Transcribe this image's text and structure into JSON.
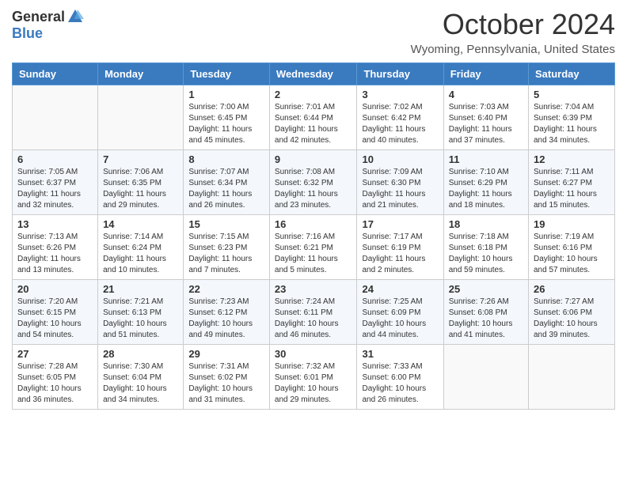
{
  "header": {
    "logo_general": "General",
    "logo_blue": "Blue",
    "month_title": "October 2024",
    "location": "Wyoming, Pennsylvania, United States"
  },
  "days_of_week": [
    "Sunday",
    "Monday",
    "Tuesday",
    "Wednesday",
    "Thursday",
    "Friday",
    "Saturday"
  ],
  "weeks": [
    [
      {
        "day": "",
        "info": ""
      },
      {
        "day": "",
        "info": ""
      },
      {
        "day": "1",
        "info": "Sunrise: 7:00 AM\nSunset: 6:45 PM\nDaylight: 11 hours and 45 minutes."
      },
      {
        "day": "2",
        "info": "Sunrise: 7:01 AM\nSunset: 6:44 PM\nDaylight: 11 hours and 42 minutes."
      },
      {
        "day": "3",
        "info": "Sunrise: 7:02 AM\nSunset: 6:42 PM\nDaylight: 11 hours and 40 minutes."
      },
      {
        "day": "4",
        "info": "Sunrise: 7:03 AM\nSunset: 6:40 PM\nDaylight: 11 hours and 37 minutes."
      },
      {
        "day": "5",
        "info": "Sunrise: 7:04 AM\nSunset: 6:39 PM\nDaylight: 11 hours and 34 minutes."
      }
    ],
    [
      {
        "day": "6",
        "info": "Sunrise: 7:05 AM\nSunset: 6:37 PM\nDaylight: 11 hours and 32 minutes."
      },
      {
        "day": "7",
        "info": "Sunrise: 7:06 AM\nSunset: 6:35 PM\nDaylight: 11 hours and 29 minutes."
      },
      {
        "day": "8",
        "info": "Sunrise: 7:07 AM\nSunset: 6:34 PM\nDaylight: 11 hours and 26 minutes."
      },
      {
        "day": "9",
        "info": "Sunrise: 7:08 AM\nSunset: 6:32 PM\nDaylight: 11 hours and 23 minutes."
      },
      {
        "day": "10",
        "info": "Sunrise: 7:09 AM\nSunset: 6:30 PM\nDaylight: 11 hours and 21 minutes."
      },
      {
        "day": "11",
        "info": "Sunrise: 7:10 AM\nSunset: 6:29 PM\nDaylight: 11 hours and 18 minutes."
      },
      {
        "day": "12",
        "info": "Sunrise: 7:11 AM\nSunset: 6:27 PM\nDaylight: 11 hours and 15 minutes."
      }
    ],
    [
      {
        "day": "13",
        "info": "Sunrise: 7:13 AM\nSunset: 6:26 PM\nDaylight: 11 hours and 13 minutes."
      },
      {
        "day": "14",
        "info": "Sunrise: 7:14 AM\nSunset: 6:24 PM\nDaylight: 11 hours and 10 minutes."
      },
      {
        "day": "15",
        "info": "Sunrise: 7:15 AM\nSunset: 6:23 PM\nDaylight: 11 hours and 7 minutes."
      },
      {
        "day": "16",
        "info": "Sunrise: 7:16 AM\nSunset: 6:21 PM\nDaylight: 11 hours and 5 minutes."
      },
      {
        "day": "17",
        "info": "Sunrise: 7:17 AM\nSunset: 6:19 PM\nDaylight: 11 hours and 2 minutes."
      },
      {
        "day": "18",
        "info": "Sunrise: 7:18 AM\nSunset: 6:18 PM\nDaylight: 10 hours and 59 minutes."
      },
      {
        "day": "19",
        "info": "Sunrise: 7:19 AM\nSunset: 6:16 PM\nDaylight: 10 hours and 57 minutes."
      }
    ],
    [
      {
        "day": "20",
        "info": "Sunrise: 7:20 AM\nSunset: 6:15 PM\nDaylight: 10 hours and 54 minutes."
      },
      {
        "day": "21",
        "info": "Sunrise: 7:21 AM\nSunset: 6:13 PM\nDaylight: 10 hours and 51 minutes."
      },
      {
        "day": "22",
        "info": "Sunrise: 7:23 AM\nSunset: 6:12 PM\nDaylight: 10 hours and 49 minutes."
      },
      {
        "day": "23",
        "info": "Sunrise: 7:24 AM\nSunset: 6:11 PM\nDaylight: 10 hours and 46 minutes."
      },
      {
        "day": "24",
        "info": "Sunrise: 7:25 AM\nSunset: 6:09 PM\nDaylight: 10 hours and 44 minutes."
      },
      {
        "day": "25",
        "info": "Sunrise: 7:26 AM\nSunset: 6:08 PM\nDaylight: 10 hours and 41 minutes."
      },
      {
        "day": "26",
        "info": "Sunrise: 7:27 AM\nSunset: 6:06 PM\nDaylight: 10 hours and 39 minutes."
      }
    ],
    [
      {
        "day": "27",
        "info": "Sunrise: 7:28 AM\nSunset: 6:05 PM\nDaylight: 10 hours and 36 minutes."
      },
      {
        "day": "28",
        "info": "Sunrise: 7:30 AM\nSunset: 6:04 PM\nDaylight: 10 hours and 34 minutes."
      },
      {
        "day": "29",
        "info": "Sunrise: 7:31 AM\nSunset: 6:02 PM\nDaylight: 10 hours and 31 minutes."
      },
      {
        "day": "30",
        "info": "Sunrise: 7:32 AM\nSunset: 6:01 PM\nDaylight: 10 hours and 29 minutes."
      },
      {
        "day": "31",
        "info": "Sunrise: 7:33 AM\nSunset: 6:00 PM\nDaylight: 10 hours and 26 minutes."
      },
      {
        "day": "",
        "info": ""
      },
      {
        "day": "",
        "info": ""
      }
    ]
  ]
}
